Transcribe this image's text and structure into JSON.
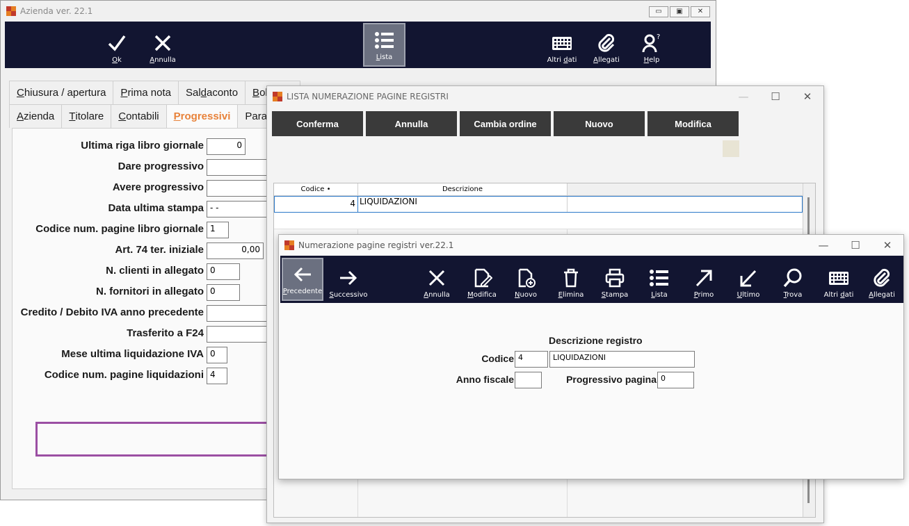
{
  "win1": {
    "title": "Azienda ver. 22.1",
    "title_buttons": [
      "▭",
      "▣",
      "✕"
    ],
    "toolbar": {
      "ok": {
        "ul": "O",
        "rest": "k",
        "icon": "check-icon"
      },
      "annulla": {
        "ul": "A",
        "rest": "nnulla",
        "icon": "x-icon"
      },
      "lista": {
        "ul": "L",
        "rest": "ista",
        "icon": "list-icon"
      },
      "altri_dati": {
        "pre": "Altri ",
        "ul": "d",
        "rest": "ati",
        "icon": "keyboard-icon"
      },
      "allegati": {
        "ul": "A",
        "rest": "llegati",
        "icon": "paperclip-icon"
      },
      "help": {
        "ul": "H",
        "rest": "elp",
        "icon": "help-person-icon"
      }
    },
    "tabs_row1": [
      {
        "ul": "C",
        "rest": "hiusura / apertura"
      },
      {
        "ul": "P",
        "rest": "rima nota"
      },
      {
        "pre": "Sal",
        "ul": "d",
        "rest": "aconto"
      },
      {
        "ul": "B",
        "rest": "ol"
      }
    ],
    "tabs_row2": [
      {
        "ul": "A",
        "rest": "zienda"
      },
      {
        "ul": "T",
        "rest": "itolare"
      },
      {
        "ul": "C",
        "rest": "ontabili"
      },
      {
        "ul": "P",
        "rest": "rogressivi"
      },
      {
        "ul": "",
        "rest": "Para"
      }
    ],
    "fields": [
      {
        "label": "Ultima riga libro giornale",
        "value": "0"
      },
      {
        "label": "Dare progressivo",
        "value": ""
      },
      {
        "label": "Avere progressivo",
        "value": ""
      },
      {
        "label": "Data ultima stampa",
        "value": " -  -"
      },
      {
        "label": "Codice num. pagine libro giornale",
        "value": "1"
      },
      {
        "label": "Art. 74 ter. iniziale",
        "value": "0,00"
      },
      {
        "label": "N. clienti in allegato",
        "value": "0"
      },
      {
        "label": "N. fornitori in allegato",
        "value": "0"
      },
      {
        "label": "Credito / Debito IVA anno precedente",
        "value": ""
      },
      {
        "label": "Trasferito a F24",
        "value": ""
      },
      {
        "label": "Mese ultima liquidazione IVA",
        "value": "0"
      },
      {
        "label": "Codice num. pagine liquidazioni",
        "value": "4"
      }
    ],
    "highlight_color": "#9b4fa3",
    "active_tab_color": "#e8823a"
  },
  "win2": {
    "title": "LISTA NUMERAZIONE PAGINE REGISTRI",
    "buttons": [
      "Conferma",
      "Annulla",
      "Cambia ordine",
      "Nuovo",
      "Modifica"
    ],
    "columns": [
      "Codice •",
      "Descrizione"
    ],
    "rows": [
      {
        "codice": "4",
        "descrizione": "LIQUIDAZIONI"
      }
    ]
  },
  "win3": {
    "title": "Numerazione pagine registri ver.22.1",
    "toolbar": [
      {
        "ul": "P",
        "rest": "recedente",
        "icon": "arrow-left-icon"
      },
      {
        "ul": "S",
        "rest": "uccessivo",
        "icon": "arrow-right-icon"
      },
      {
        "ul": "A",
        "rest": "nnulla",
        "icon": "x-icon"
      },
      {
        "ul": "M",
        "rest": "odifica",
        "icon": "edit-icon"
      },
      {
        "ul": "N",
        "rest": "uovo",
        "icon": "new-document-icon"
      },
      {
        "ul": "E",
        "rest": "limina",
        "icon": "trash-icon"
      },
      {
        "ul": "S",
        "rest": "tampa",
        "icon": "printer-icon"
      },
      {
        "ul": "L",
        "rest": "ista",
        "icon": "list-icon"
      },
      {
        "ul": "P",
        "rest": "rimo",
        "icon": "arrow-up-right-icon"
      },
      {
        "ul": "U",
        "rest": "ltimo",
        "icon": "arrow-down-left-icon"
      },
      {
        "ul": "T",
        "rest": "rova",
        "icon": "search-icon"
      },
      {
        "pre": "Altri ",
        "ul": "d",
        "rest": "ati",
        "icon": "keyboard-icon"
      },
      {
        "ul": "A",
        "rest": "llegati",
        "icon": "paperclip-icon"
      }
    ],
    "form": {
      "header": "Descrizione registro",
      "codice_label": "Codice",
      "codice_value": "4",
      "descrizione_value": "LIQUIDAZIONI",
      "anno_label": "Anno fiscale",
      "anno_value": "",
      "progressivo_label": "Progressivo pagina",
      "progressivo_value": "0"
    }
  },
  "window_controls": {
    "minimize": "—",
    "maximize": "☐",
    "close": "✕"
  },
  "colors": {
    "toolbar_bg": "#121531",
    "button_bg": "#3a3a3a"
  }
}
